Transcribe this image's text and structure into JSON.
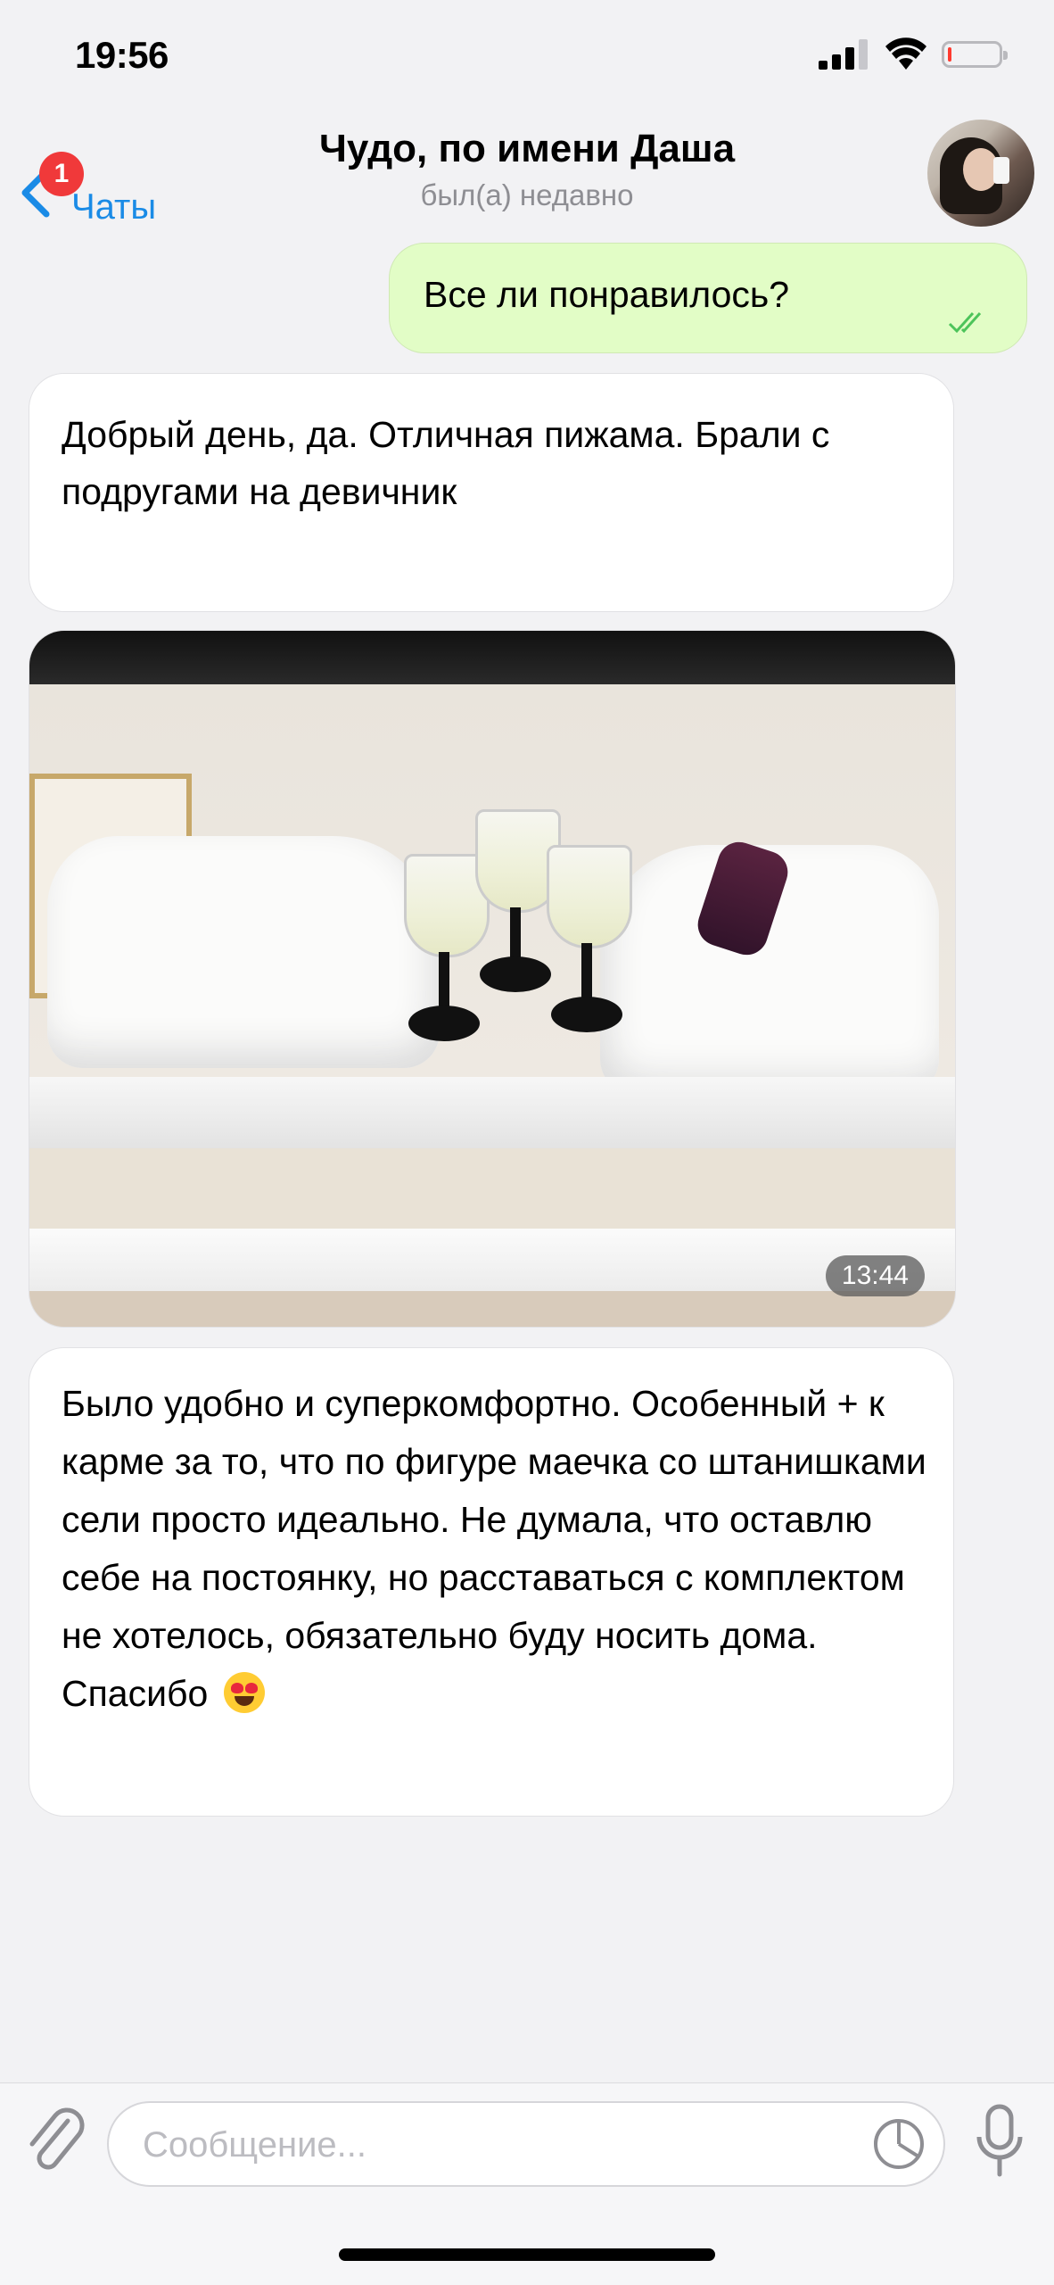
{
  "status_bar": {
    "time": "19:56"
  },
  "header": {
    "back_label": "Чаты",
    "unread_badge": "1",
    "title": "Чудо, по имени Даша",
    "subtitle": "был(а) недавно"
  },
  "messages": {
    "outgoing_1": {
      "text": "Все ли понравилось?"
    },
    "incoming_1": {
      "text": "Добрый день, да. Отличная пижама. Брали с подругами на девичник"
    },
    "photo": {
      "time": "13:44"
    },
    "incoming_2": {
      "text": "Было удобно и суперкомфортно. Особенный + к карме за то, что по фигуре маечка со штанишками сели просто идеально. Не думала, что оставлю себе на постоянку, но расставаться с комплектом не хотелось, обязательно буду носить дома. Спасибо"
    }
  },
  "input": {
    "placeholder": "Сообщение..."
  },
  "colors": {
    "accent": "#1a8be6",
    "outgoing_bubble": "#e2fdc6",
    "badge": "#f0393a"
  }
}
